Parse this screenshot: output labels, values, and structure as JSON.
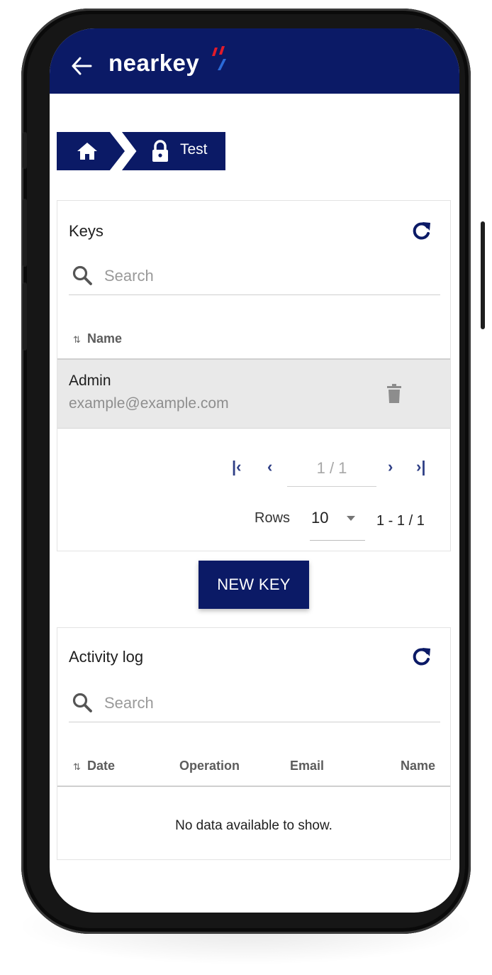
{
  "app": {
    "logo_text": "nearkey",
    "brand_colors": {
      "primary": "#0b1a66",
      "accent_red": "#e21b2a",
      "accent_blue": "#2b6ad8"
    }
  },
  "breadcrumb": {
    "home_icon": "home-icon",
    "current_icon": "lock-icon",
    "current_label": "Test"
  },
  "keys_panel": {
    "title": "Keys",
    "search_placeholder": "Search",
    "columns": [
      {
        "label": "Name",
        "sortable": true
      }
    ],
    "rows": [
      {
        "name": "Admin",
        "email": "example@example.com"
      }
    ],
    "pagination": {
      "page_indicator": "1 / 1",
      "rows_label": "Rows",
      "rows_per_page": "10",
      "range_text": "1 - 1 / 1"
    }
  },
  "new_key_button": {
    "label": "NEW KEY"
  },
  "activity_panel": {
    "title": "Activity log",
    "search_placeholder": "Search",
    "columns": [
      {
        "label": "Date",
        "sortable": true
      },
      {
        "label": "Operation"
      },
      {
        "label": "Email"
      },
      {
        "label": "Name"
      }
    ],
    "empty_message": "No data available to show."
  }
}
